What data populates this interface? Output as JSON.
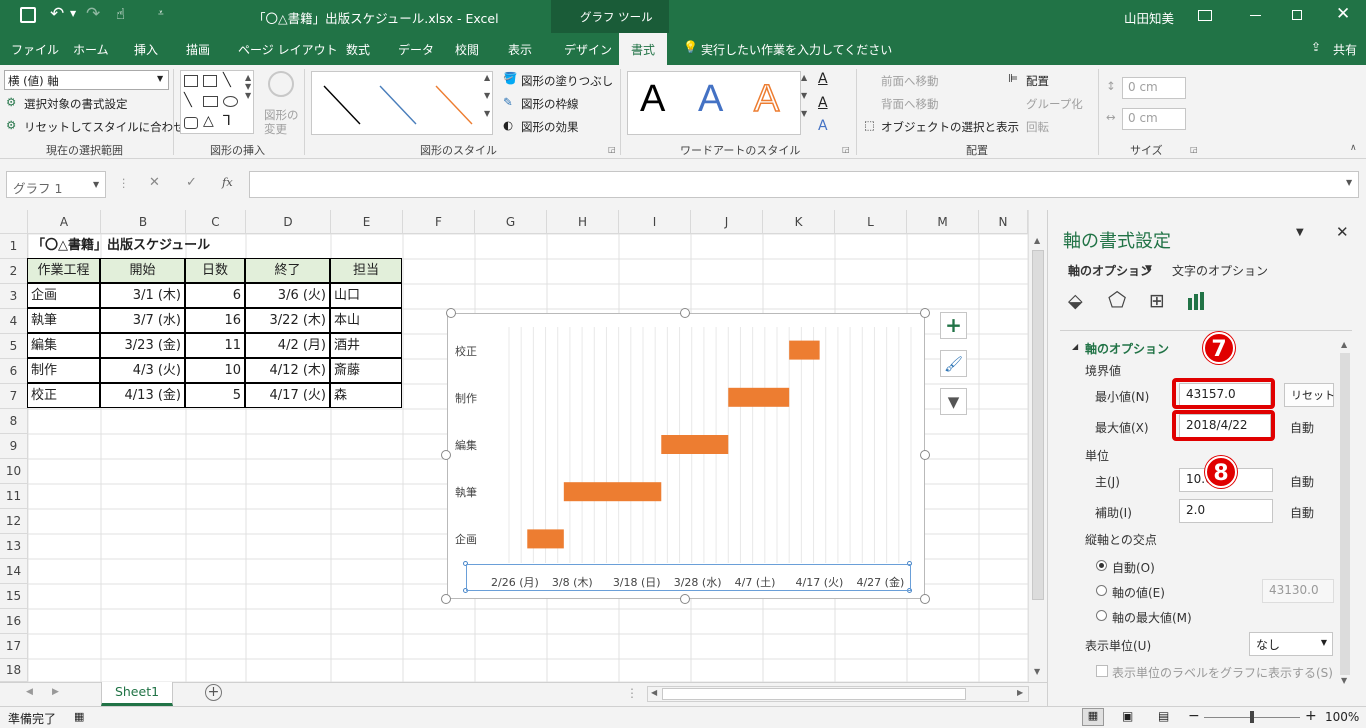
{
  "window": {
    "title": "「〇△書籍」出版スケジュール.xlsx - Excel",
    "context_tool": "グラフ ツール",
    "user": "山田知美"
  },
  "tabs": [
    "ファイル",
    "ホーム",
    "挿入",
    "描画",
    "ページ レイアウト",
    "数式",
    "データ",
    "校閲",
    "表示",
    "デザイン",
    "書式"
  ],
  "tell_me": "実行したい作業を入力してください",
  "share": "共有",
  "ribbon": {
    "selection_dropdown": "横 (値) 軸",
    "format_selection": "選択対象の書式設定",
    "reset_style": "リセットしてスタイルに合わせる",
    "group_current": "現在の選択範囲",
    "change_shape": "図形の\n変更",
    "change_shape_1": "図形の",
    "change_shape_2": "変更",
    "group_insert_shapes": "図形の挿入",
    "shape_fill": "図形の塗りつぶし",
    "shape_outline": "図形の枠線",
    "shape_effects": "図形の効果",
    "group_shape_styles": "図形のスタイル",
    "wordart_letter": "A",
    "group_wordart": "ワードアートのスタイル",
    "bring_forward": "前面へ移動",
    "send_backward": "背面へ移動",
    "selection_pane": "オブジェクトの選択と表示",
    "align": "配置",
    "group": "グループ化",
    "rotate": "回転",
    "group_arrange": "配置",
    "height": "0 cm",
    "width": "0 cm",
    "group_size": "サイズ",
    "colors": {
      "accent": "#217346",
      "bar": "#ed7d31"
    }
  },
  "formula_bar": {
    "name_box": "グラフ 1",
    "value": ""
  },
  "columns": [
    "A",
    "B",
    "C",
    "D",
    "E",
    "F",
    "G",
    "H",
    "I",
    "J",
    "K",
    "L",
    "M",
    "N"
  ],
  "rows": [
    "1",
    "2",
    "3",
    "4",
    "5",
    "6",
    "7",
    "8",
    "9",
    "10",
    "11",
    "12",
    "13",
    "14",
    "15",
    "16",
    "17",
    "18"
  ],
  "sheet": {
    "title": "「〇△書籍」出版スケジュール",
    "headers": [
      "作業工程",
      "開始",
      "日数",
      "終了",
      "担当"
    ],
    "data": [
      [
        "企画",
        "3/1 (木)",
        "6",
        "3/6 (火)",
        "山口"
      ],
      [
        "執筆",
        "3/7 (水)",
        "16",
        "3/22 (木)",
        "本山"
      ],
      [
        "編集",
        "3/23 (金)",
        "11",
        "4/2 (月)",
        "酒井"
      ],
      [
        "制作",
        "4/3 (火)",
        "10",
        "4/12 (木)",
        "斎藤"
      ],
      [
        "校正",
        "4/13 (金)",
        "5",
        "4/17 (火)",
        "森"
      ]
    ]
  },
  "chart_data": {
    "type": "bar",
    "orientation": "horizontal-stacked-gantt",
    "categories": [
      "企画",
      "執筆",
      "編集",
      "制作",
      "校正"
    ],
    "series": [
      {
        "values": [
          "2018/3/1",
          "2018/3/7",
          "2018/3/23",
          "2018/4/3",
          "2018/4/13"
        ],
        "hidden": true
      },
      {
        "values": [
          6,
          16,
          11,
          10,
          5
        ],
        "color": "#ed7d31"
      }
    ],
    "xlim": [
      "2018/2/26",
      "2018/5/3"
    ],
    "x_major_unit_days": 10,
    "x_tick_labels": [
      "2/26 (月)",
      "3/8 (木)",
      "3/18 (日)",
      "3/28 (水)",
      "4/7 (土)",
      "4/17 (火)",
      "4/27 (金)"
    ],
    "grid": true,
    "legend": "none"
  },
  "format_pane": {
    "title": "軸の書式設定",
    "tab_axis_options": "軸のオプション",
    "tab_text_options": "文字のオプション",
    "section": "軸のオプション",
    "bounds_label": "境界値",
    "min_label": "最小値(N)",
    "min_value": "43157.0",
    "reset": "リセット",
    "max_label": "最大値(X)",
    "max_value": "2018/4/22",
    "auto": "自動",
    "units_label": "単位",
    "major_label": "主(J)",
    "major_value": "10.0",
    "minor_label": "補助(I)",
    "minor_value": "2.0",
    "cross_label": "縦軸との交点",
    "cross_auto": "自動(O)",
    "cross_value": "軸の値(E)",
    "cross_value_num": "43130.0",
    "cross_max": "軸の最大値(M)",
    "display_units_label": "表示単位(U)",
    "display_units_value": "なし",
    "show_units_label": "表示単位のラベルをグラフに表示する(S)",
    "badge7": "7",
    "badge8": "8"
  },
  "sheet_tab": "Sheet1",
  "status": {
    "ready": "準備完了",
    "zoom": "100%"
  }
}
